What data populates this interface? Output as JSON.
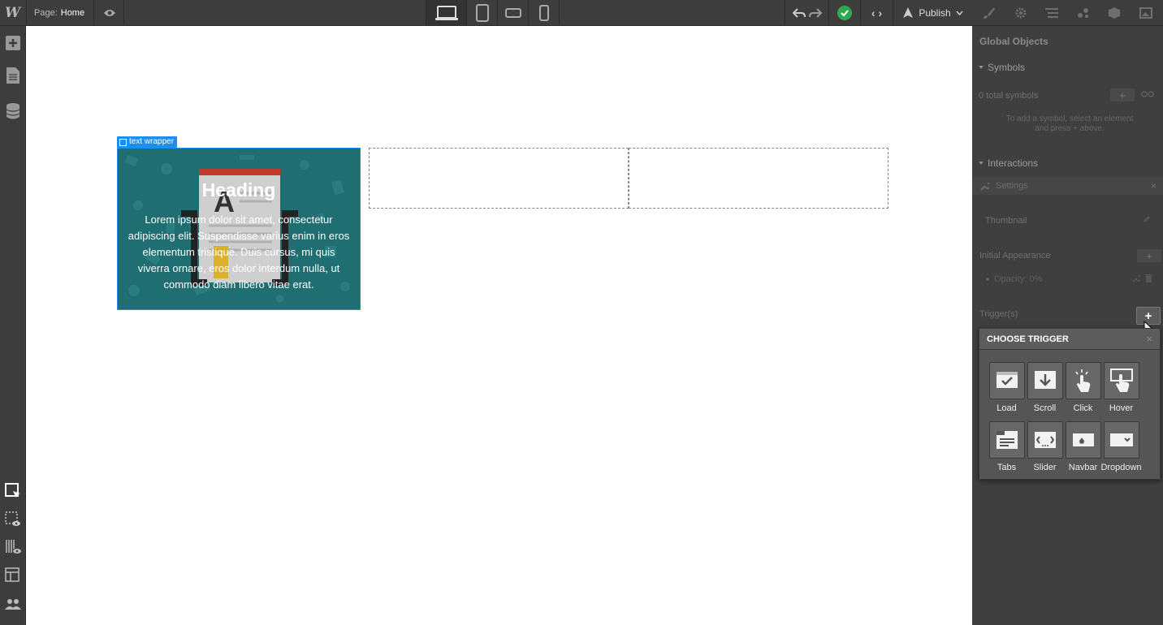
{
  "topbar": {
    "logo": "W",
    "page_label": "Page:",
    "page_name": "Home",
    "publish_label": "Publish",
    "code_label": "‹ ›"
  },
  "canvas": {
    "selected_element_label": "text wrapper",
    "hero_heading": "Heading",
    "hero_text": "Lorem ipsum dolor sit amet, consectetur adipiscing elit. Suspendisse varius enim in eros elementum tristique. Duis cursus, mi quis viverra ornare, eros dolor interdum nulla, ut commodo diam libero vitae erat."
  },
  "panel": {
    "title": "Global Objects",
    "symbols": {
      "header": "Symbols",
      "count_text": "0 total symbols",
      "hint_line1": "To add a symbol, select an element",
      "hint_line2": "and press + above."
    },
    "interactions": {
      "header": "Interactions",
      "settings_label": "Settings",
      "thumbnail_label": "Thumbnail",
      "initial_appearance_label": "Initial Appearance",
      "opacity_label": "Opacity: 0%",
      "triggers_label": "Trigger(s)"
    },
    "choose_trigger": {
      "title": "CHOOSE TRIGGER",
      "close": "×",
      "items": [
        {
          "label": "Load",
          "icon": "load-icon"
        },
        {
          "label": "Scroll",
          "icon": "scroll-icon"
        },
        {
          "label": "Click",
          "icon": "click-icon"
        },
        {
          "label": "Hover",
          "icon": "hover-icon"
        },
        {
          "label": "Tabs",
          "icon": "tabs-icon"
        },
        {
          "label": "Slider",
          "icon": "slider-icon"
        },
        {
          "label": "Navbar",
          "icon": "navbar-icon"
        },
        {
          "label": "Dropdown",
          "icon": "dropdown-icon"
        }
      ]
    }
  },
  "colors": {
    "accent": "#1b8ff0",
    "success": "#2fa84f",
    "hero_bg": "#1f6f72",
    "ui_dark": "#3d3d3d"
  }
}
